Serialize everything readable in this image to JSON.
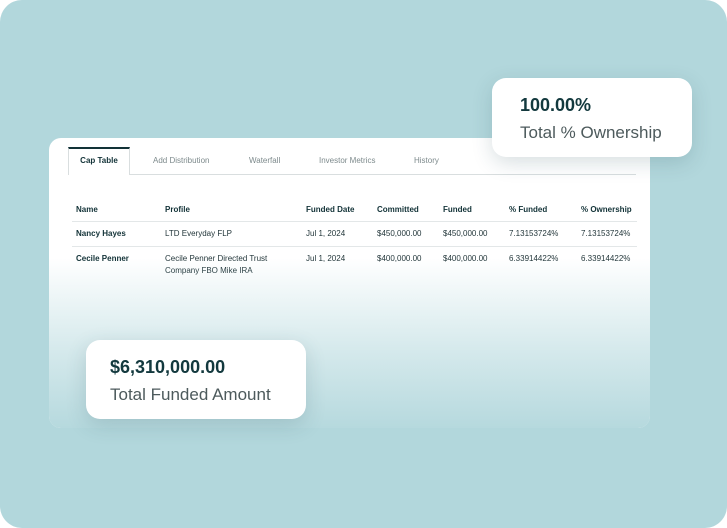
{
  "tabs": [
    {
      "label": "Cap Table",
      "active": true
    },
    {
      "label": "Add Distribution",
      "active": false
    },
    {
      "label": "Waterfall",
      "active": false
    },
    {
      "label": "Investor Metrics",
      "active": false
    },
    {
      "label": "History",
      "active": false
    }
  ],
  "table": {
    "headers": [
      "Name",
      "Profile",
      "Funded Date",
      "Committed",
      "Funded",
      "% Funded",
      "% Ownership"
    ],
    "rows": [
      {
        "name": "Nancy Hayes",
        "profile": "LTD Everyday FLP",
        "funded_date": "Jul 1, 2024",
        "committed": "$450,000.00",
        "funded": "$450,000.00",
        "pct_funded": "7.13153724%",
        "pct_ownership": "7.13153724%"
      },
      {
        "name": "Cecile Penner",
        "profile_line1": "Cecile Penner Directed Trust",
        "profile_line2": "Company FBO Mike IRA",
        "funded_date": "Jul 1, 2024",
        "committed": "$400,000.00",
        "funded": "$400,000.00",
        "pct_funded": "6.33914422%",
        "pct_ownership": "6.33914422%"
      }
    ]
  },
  "callouts": {
    "ownership": {
      "value": "100.00%",
      "label": "Total % Ownership"
    },
    "funded": {
      "value": "$6,310,000.00",
      "label": "Total Funded Amount"
    }
  },
  "colors": {
    "background": "#b2d7dc",
    "accent": "#123237"
  }
}
